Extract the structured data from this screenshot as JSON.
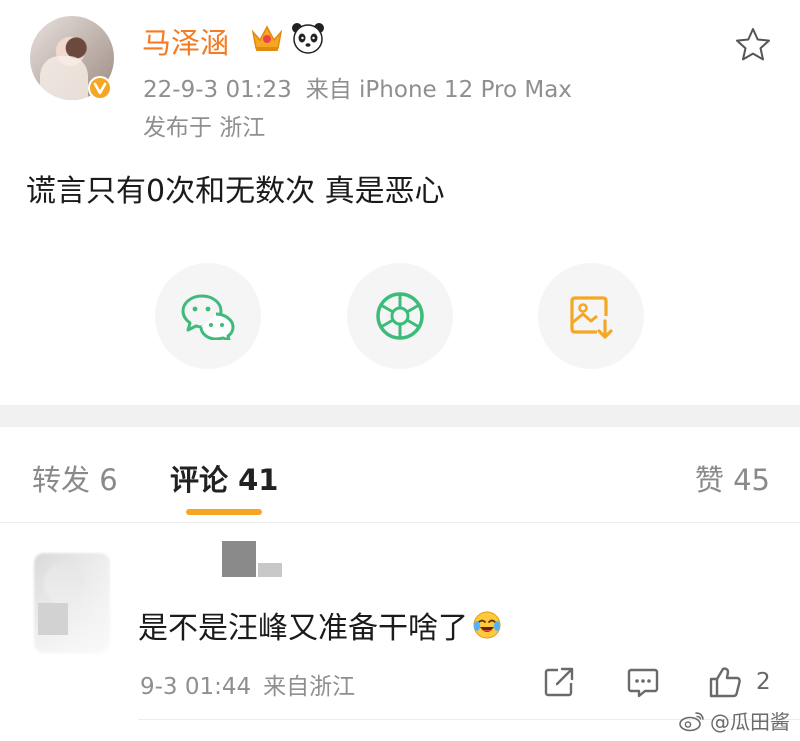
{
  "post": {
    "author": "马泽涵",
    "timestamp": "22-9-3 01:23",
    "source": "来自 iPhone 12 Pro Max",
    "location": "发布于 浙江",
    "text": "谎言只有0次和无数次 真是恶心",
    "badges": [
      "crown-icon",
      "panda-icon",
      "verified-icon"
    ]
  },
  "share": {
    "items": [
      "wechat-icon",
      "moments-icon",
      "save-image-icon"
    ],
    "colors": {
      "wechat": "#3dbb7a",
      "moments": "#3dbb7a",
      "save": "#f5a623"
    }
  },
  "tabs": {
    "repost": "转发 6",
    "comment": "评论 41",
    "like": "赞 45"
  },
  "comment": {
    "text": "是不是汪峰又准备干啥了",
    "emoji": "laugh-cry-icon",
    "timestamp": "9-3 01:44",
    "location": "来自浙江",
    "like_count": "2"
  },
  "watermark": "@瓜田酱",
  "colors": {
    "username": "#f57b20",
    "accent": "#f5a623",
    "meta": "#8f8f8f"
  }
}
